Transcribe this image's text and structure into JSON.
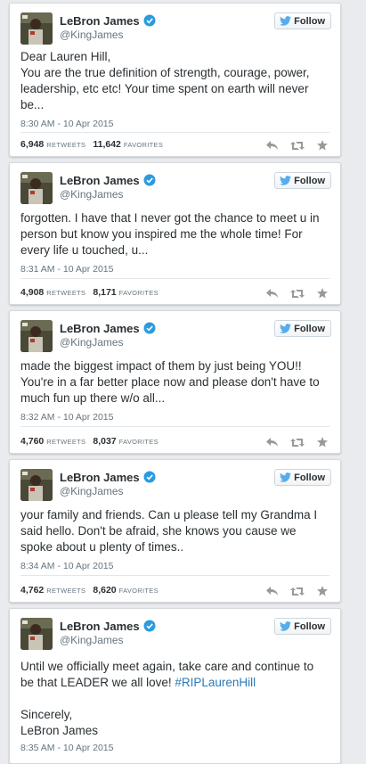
{
  "author": {
    "display_name": "LeBron James",
    "handle": "@KingJames",
    "avatar_icon": "avatar-photo"
  },
  "follow_label": "Follow",
  "colors": {
    "verified_blue": "#2b9bde",
    "hashtag": "#2b7bb9",
    "action_gray": "#999999"
  },
  "tweets": [
    {
      "text": "Dear Lauren Hill,\nYou are the true definition of strength, courage, power, leadership, etc etc! Your time spent on earth will never be...",
      "timestamp": "8:30 AM - 10 Apr 2015",
      "retweets": "6,948",
      "retweets_label": "RETWEETS",
      "favorites": "11,642",
      "favorites_label": "FAVORITES"
    },
    {
      "text": "forgotten. I have that I never got the chance to meet u in person but know you inspired me the whole time! For every life u touched, u...",
      "timestamp": "8:31 AM - 10 Apr 2015",
      "retweets": "4,908",
      "retweets_label": "RETWEETS",
      "favorites": "8,171",
      "favorites_label": "FAVORITES"
    },
    {
      "text": "made the biggest impact of them by just being YOU!! You're in a far better place now and please don't have to much fun up there w/o all...",
      "timestamp": "8:32 AM - 10 Apr 2015",
      "retweets": "4,760",
      "retweets_label": "RETWEETS",
      "favorites": "8,037",
      "favorites_label": "FAVORITES"
    },
    {
      "text": "your family and friends. Can u please tell my Grandma I said hello. Don't be afraid, she knows you cause we spoke about u plenty of times..",
      "timestamp": "8:34 AM - 10 Apr 2015",
      "retweets": "4,762",
      "retweets_label": "RETWEETS",
      "favorites": "8,620",
      "favorites_label": "FAVORITES"
    },
    {
      "text_before": "Until we officially meet again, take care and continue to be that LEADER we all love! ",
      "hashtag": "#RIPLaurenHill",
      "text_after": "\n\nSincerely,\nLeBron James",
      "timestamp": "8:35 AM - 10 Apr 2015"
    }
  ]
}
